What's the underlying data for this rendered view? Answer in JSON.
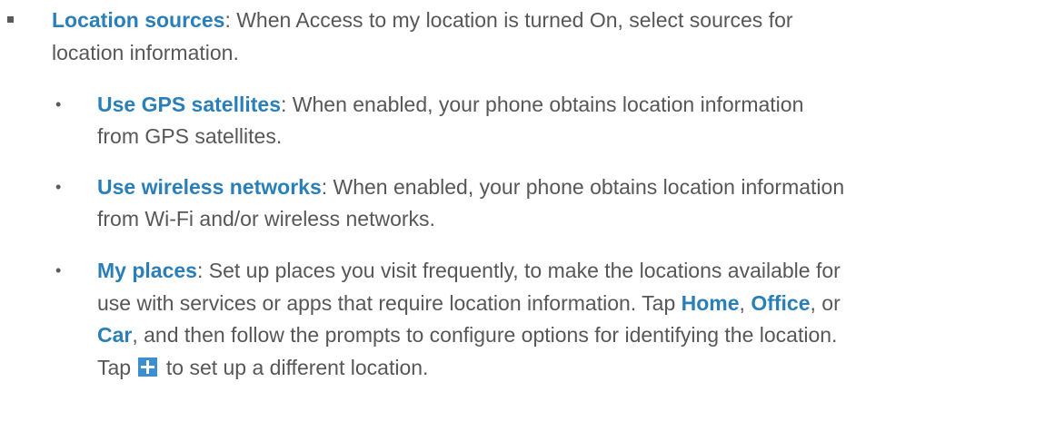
{
  "location_sources": {
    "term": "Location sources",
    "line1": ": When Access to my location is turned On, select sources for",
    "line2": "location information."
  },
  "gps": {
    "term": "Use GPS satellites",
    "line1": ": When enabled, your phone obtains location information",
    "line2": "from GPS satellites."
  },
  "wireless": {
    "term": "Use wireless networks",
    "line1": ": When enabled, your phone obtains location information",
    "line2": "from Wi-Fi and/or wireless networks."
  },
  "my_places": {
    "term": "My places",
    "line1": ": Set up places you visit frequently, to make the locations available for",
    "line2_pre": "use with services or apps that require location information. Tap ",
    "home": "Home",
    "sep1": ", ",
    "office": "Office",
    "sep2": ", or",
    "car": "Car",
    "line3_post": ", and then follow the prompts to configure options for identifying the location.",
    "line4_pre": "Tap ",
    "line4_post": " to set up a different location."
  },
  "bullets": {
    "dot": "•"
  },
  "icons": {
    "add": "plus-icon"
  },
  "colors": {
    "text": "#575757",
    "term": "#2a7fb8",
    "icon_bg": "#3b8fd0"
  }
}
